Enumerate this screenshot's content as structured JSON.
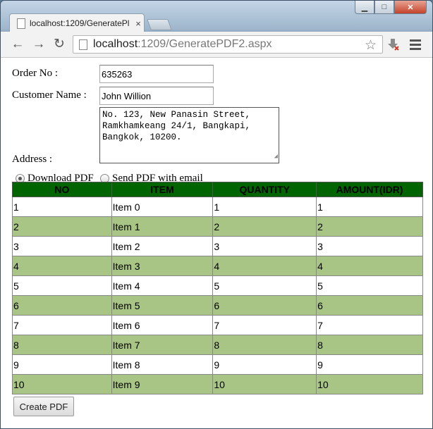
{
  "tab": {
    "title": "localhost:1209/GeneratePl",
    "close": "×"
  },
  "address": {
    "host": "localhost",
    "path": ":1209/GeneratePDF2.aspx"
  },
  "form": {
    "order_label": "Order No :",
    "order_value": "635263",
    "customer_label": "Customer Name :",
    "customer_value": "John Willion",
    "address_label": "Address :",
    "address_value": "No. 123, New Panasin Street,\nRamkhamkeang 24/1, Bangkapi,\nBangkok, 10200.",
    "radio_download": "Download PDF",
    "radio_email": "Send PDF with email",
    "button": "Create PDF"
  },
  "table": {
    "headers": [
      "NO",
      "ITEM",
      "QUANTITY",
      "AMOUNT(IDR)"
    ],
    "rows": [
      [
        "1",
        "Item 0",
        "1",
        "1"
      ],
      [
        "2",
        "Item 1",
        "2",
        "2"
      ],
      [
        "3",
        "Item 2",
        "3",
        "3"
      ],
      [
        "4",
        "Item 3",
        "4",
        "4"
      ],
      [
        "5",
        "Item 4",
        "5",
        "5"
      ],
      [
        "6",
        "Item 5",
        "6",
        "6"
      ],
      [
        "7",
        "Item 6",
        "7",
        "7"
      ],
      [
        "8",
        "Item 7",
        "8",
        "8"
      ],
      [
        "9",
        "Item 8",
        "9",
        "9"
      ],
      [
        "10",
        "Item 9",
        "10",
        "10"
      ]
    ]
  },
  "colors": {
    "header_bg": "#006400",
    "alt_row": "#a8c585"
  }
}
